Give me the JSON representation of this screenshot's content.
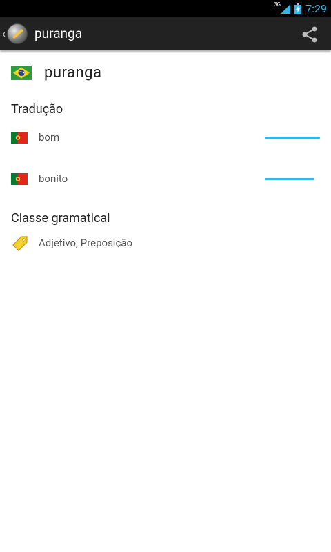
{
  "status_bar": {
    "network": "3G",
    "time": "7:29"
  },
  "action_bar": {
    "title": "puranga"
  },
  "entry": {
    "word": "puranga"
  },
  "translation_section": {
    "title": "Tradução",
    "items": [
      {
        "text": "bom",
        "strength": 1.0
      },
      {
        "text": "bonito",
        "strength": 0.9
      }
    ]
  },
  "class_section": {
    "title": "Classe gramatical",
    "value": "Adjetivo, Preposição"
  },
  "colors": {
    "accent": "#33b5e5",
    "action_bar": "#222222"
  }
}
